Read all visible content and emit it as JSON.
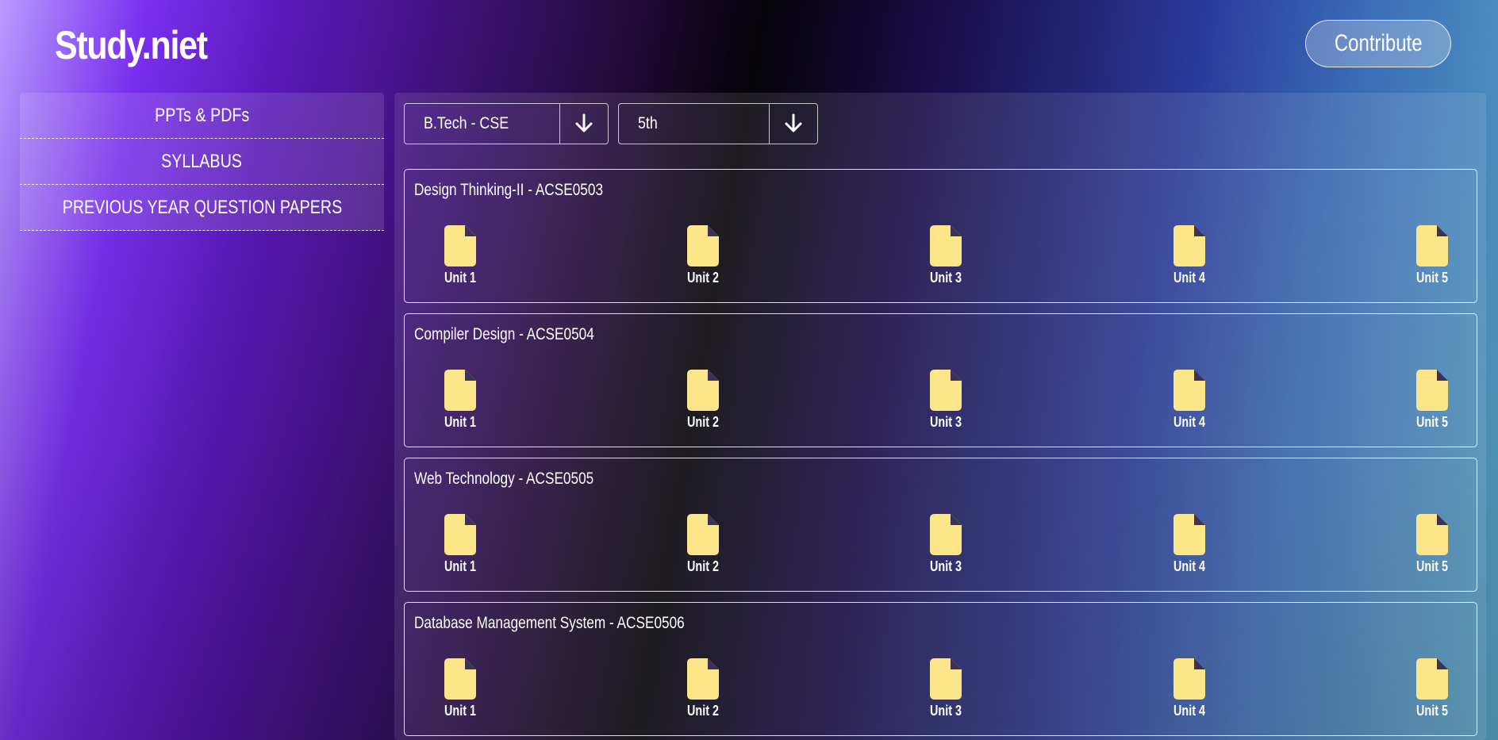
{
  "brand": {
    "title": "Study.niet"
  },
  "header": {
    "contribute_label": "Contribute"
  },
  "sidebar": {
    "items": [
      {
        "label": "PPTs & PDFs"
      },
      {
        "label": "SYLLABUS"
      },
      {
        "label": "PREVIOUS YEAR QUESTION PAPERS"
      }
    ]
  },
  "filters": {
    "course": {
      "value": "B.Tech - CSE",
      "icon": "arrow-down-icon"
    },
    "semester": {
      "value": "5th",
      "icon": "arrow-down-icon"
    }
  },
  "subjects": [
    {
      "title": "Design Thinking-II - ACSE0503",
      "units": [
        "Unit 1",
        "Unit 2",
        "Unit 3",
        "Unit 4",
        "Unit 5"
      ]
    },
    {
      "title": "Compiler Design - ACSE0504",
      "units": [
        "Unit 1",
        "Unit 2",
        "Unit 3",
        "Unit 4",
        "Unit 5"
      ]
    },
    {
      "title": "Web Technology - ACSE0505",
      "units": [
        "Unit 1",
        "Unit 2",
        "Unit 3",
        "Unit 4",
        "Unit 5"
      ]
    },
    {
      "title": "Database Management System - ACSE0506",
      "units": [
        "Unit 1",
        "Unit 2",
        "Unit 3",
        "Unit 4",
        "Unit 5"
      ]
    }
  ],
  "colors": {
    "file_icon": "#fde68a",
    "file_fold": "#3b3357",
    "border": "#ffffff"
  },
  "icons": {
    "unit_file": "file-icon"
  }
}
